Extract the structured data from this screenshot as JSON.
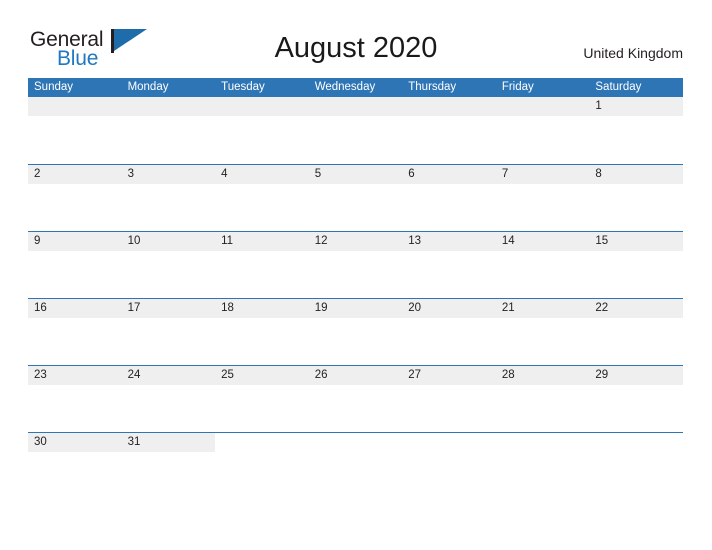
{
  "brand": {
    "name_part1": "General",
    "name_part2": "Blue",
    "flag_icon": "flag-icon",
    "colors": {
      "black": "#231f20",
      "blue": "#1f78c1",
      "flag_blue": "#1f6cab"
    }
  },
  "header": {
    "title": "August 2020",
    "country": "United Kingdom"
  },
  "calendar": {
    "colors": {
      "header_blue": "#2e75b6",
      "row_divider": "#2e75b6",
      "date_band_gray": "#efefef",
      "text": "#231f20",
      "header_text": "#ffffff"
    },
    "weekday_headers": [
      "Sunday",
      "Monday",
      "Tuesday",
      "Wednesday",
      "Thursday",
      "Friday",
      "Saturday"
    ],
    "weeks": [
      [
        "",
        "",
        "",
        "",
        "",
        "",
        "1"
      ],
      [
        "2",
        "3",
        "4",
        "5",
        "6",
        "7",
        "8"
      ],
      [
        "9",
        "10",
        "11",
        "12",
        "13",
        "14",
        "15"
      ],
      [
        "16",
        "17",
        "18",
        "19",
        "20",
        "21",
        "22"
      ],
      [
        "23",
        "24",
        "25",
        "26",
        "27",
        "28",
        "29"
      ],
      [
        "30",
        "31",
        "",
        "",
        "",
        "",
        ""
      ]
    ]
  }
}
